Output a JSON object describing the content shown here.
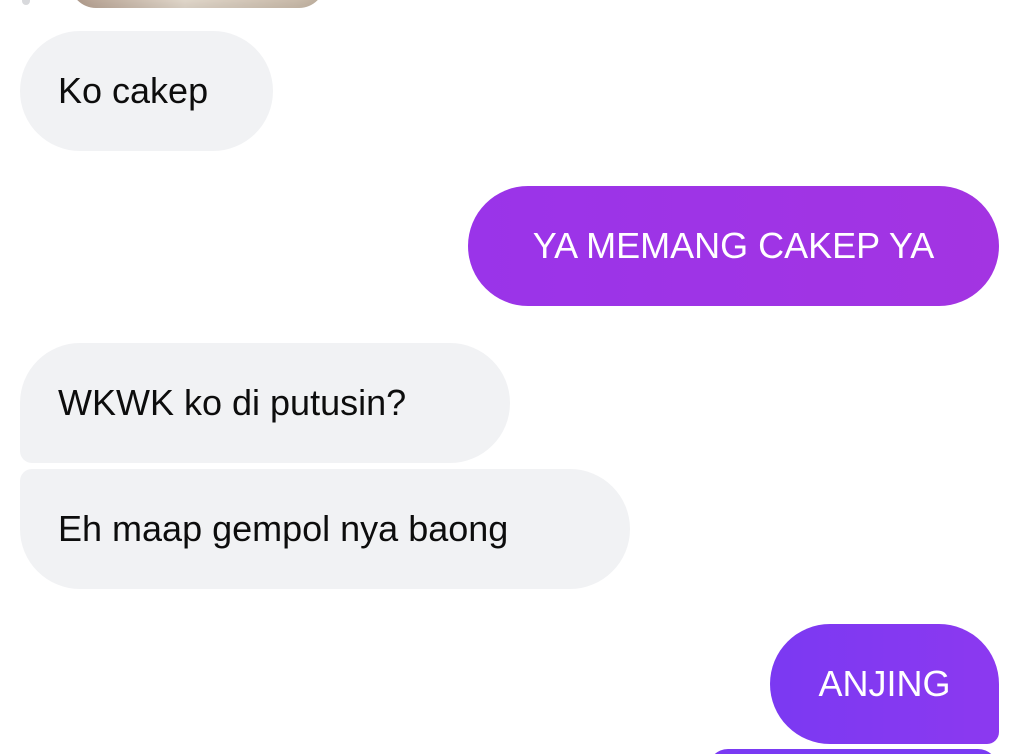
{
  "conversation": {
    "messages": [
      {
        "text": "Ko cakep",
        "sender": "incoming"
      },
      {
        "text": "YA MEMANG CAKEP YA",
        "sender": "outgoing"
      },
      {
        "text": "WKWK ko di putusin?",
        "sender": "incoming"
      },
      {
        "text": "Eh maap gempol nya baong",
        "sender": "incoming"
      },
      {
        "text": "ANJING",
        "sender": "outgoing"
      }
    ]
  },
  "colors": {
    "incoming_bubble": "#f1f2f4",
    "incoming_text": "#0d0d0d",
    "outgoing_purple": "#a334e2",
    "outgoing_violet": "#7b39f2",
    "background": "#ffffff"
  }
}
